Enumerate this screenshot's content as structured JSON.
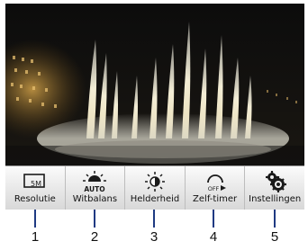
{
  "toolbar": {
    "buttons": [
      {
        "label": "Resolutie",
        "icon": "resolution-icon",
        "icon_text": "5M"
      },
      {
        "label": "Witbalans",
        "icon": "white-balance-icon",
        "icon_text": "AUTO"
      },
      {
        "label": "Helderheid",
        "icon": "brightness-icon"
      },
      {
        "label": "Zelf-timer",
        "icon": "self-timer-icon",
        "icon_text": "OFF"
      },
      {
        "label": "Instellingen",
        "icon": "settings-icon"
      }
    ]
  },
  "callouts": [
    "1",
    "2",
    "3",
    "4",
    "5"
  ],
  "colors": {
    "callout_line": "#1f3a82",
    "toolbar_top": "#fbfbfb",
    "toolbar_bottom": "#d8d8d8"
  }
}
